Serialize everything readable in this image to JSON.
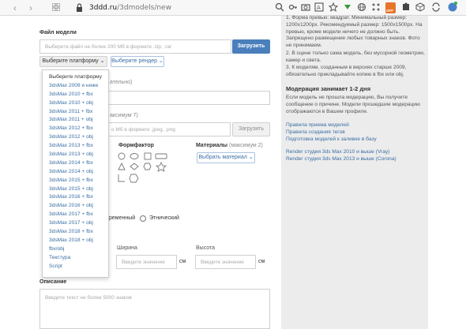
{
  "browser": {
    "url_domain": "3ddd.ru",
    "url_path": "/3dmodels/new",
    "badge_text": "OFF"
  },
  "form": {
    "file_label": "Файл модели",
    "file_placeholder": "Выберите файл не более 200 Мб в формате .zip, .rar",
    "upload_button": "Загрузить",
    "platform_button": "Выберите платформу",
    "render_button": "Выберите рендер",
    "hidden_label_fragment": "ательно)",
    "preview_label_fragment": "аксимум 7)",
    "preview_placeholder_fragment": "о Мб в формате .jpeg, .png",
    "preview_upload_button": "Загрузить",
    "formfactor_label": "Формфактор",
    "materials_label": "Материалы",
    "materials_hint": "(максимум 2)",
    "materials_button": "Выбрать материал",
    "style_modern": "ременный",
    "style_ethnic": "Этнический",
    "width_label": "Ширина",
    "height_label": "Высота",
    "width_placeholder": "Введите значение",
    "height_placeholder": "Введите значение",
    "unit_cm_1": "см",
    "unit_cm_2": "см",
    "description_label": "Описание",
    "description_placeholder": "Введите текст не более 5000 знаков"
  },
  "platform_dropdown": {
    "items": [
      "Выберите платформу",
      "3dsMax 2009 и ниже",
      "3dsMax 2010 + fbx",
      "3dsMax 2010 + obj",
      "3dsMax 2011 + fbx",
      "3dsMax 2011 + obj",
      "3dsMax 2012 + fbx",
      "3dsMax 2012 + obj",
      "3dsMax 2013 + fbx",
      "3dsMax 2013 + obj",
      "3dsMax 2014 + fbx",
      "3dsMax 2014 + obj",
      "3dsMax 2015 + fbx",
      "3dsMax 2015 + obj",
      "3dsMax 2016 + fbx",
      "3dsMax 2016 + obj",
      "3dsMax 2017 + fbx",
      "3dsMax 2017 + obj",
      "3dsMax 2018 + fbx",
      "3dsMax 2018 + obj",
      "fbx/obj",
      "Текстура",
      "Script"
    ]
  },
  "sidebar": {
    "rule_1": "1. Форма превью: квадрат. Минимальный размер: 1200x1200px. Рекомендуемый размер: 1500x1500px. На превью, кроме модели ничего не должно быть. Запрещено размещение любых товарных знаков. Фото не принимаем.",
    "rule_2": "2. В сцене только сама модель, без мусорной геометрии, камер и света.",
    "rule_3": "3. К моделям, созданным в версиях старше 2009, обязательно прикладывайте копию в fbx или obj.",
    "moderation_title": "Модерация занимает 1-2 дня",
    "moderation_text": "Если модель не прошла модерацию, Вы получите сообщение о причине. Модели прошедшие модерацию отображаются в Вашем профиле.",
    "links": [
      "Правила приема моделей",
      "Правила создания тегов",
      "Подготовка моделей к заливке в базу"
    ],
    "render_links": [
      "Render студия 3ds Max 2010 и выше (Vray)",
      "Render студия 3ds Max 2013 и выше (Corona)"
    ]
  },
  "colors": {
    "primary": "#4a7fbc",
    "link": "#3a6ea5",
    "sidebar_bg": "#ececec"
  }
}
